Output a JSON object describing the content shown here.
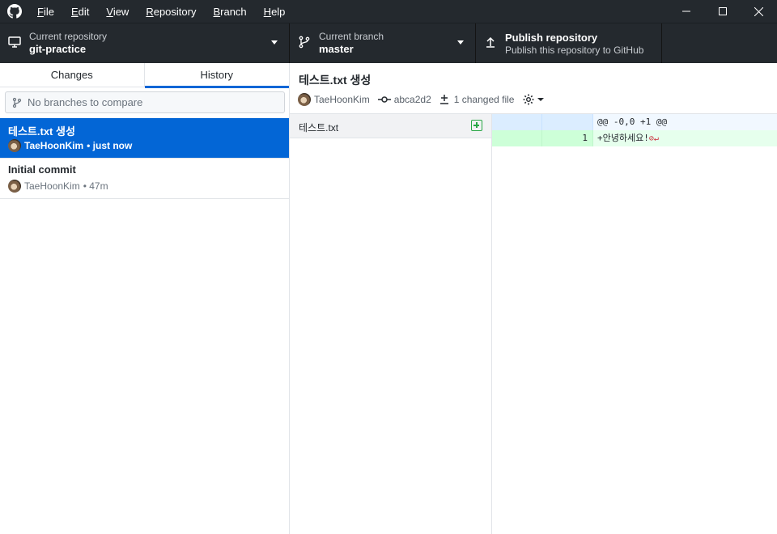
{
  "menu": {
    "items": [
      {
        "u": "F",
        "rest": "ile"
      },
      {
        "u": "E",
        "rest": "dit"
      },
      {
        "u": "V",
        "rest": "iew"
      },
      {
        "u": "R",
        "rest": "epository"
      },
      {
        "u": "B",
        "rest": "ranch"
      },
      {
        "u": "H",
        "rest": "elp"
      }
    ]
  },
  "toolbar": {
    "repo": {
      "caption": "Current repository",
      "value": "git-practice"
    },
    "branch": {
      "caption": "Current branch",
      "value": "master"
    },
    "publish": {
      "title": "Publish repository",
      "subtitle": "Publish this repository to GitHub"
    }
  },
  "sidebar": {
    "tabs": [
      {
        "label": "Changes"
      },
      {
        "label": "History"
      }
    ],
    "compare_placeholder": "No branches to compare",
    "commits": [
      {
        "title": "테스트.txt 생성",
        "author": "TaeHoonKim",
        "time": "• just now"
      },
      {
        "title": "Initial commit",
        "author": "TaeHoonKim",
        "time": "• 47m"
      }
    ]
  },
  "detail": {
    "title": "테스트.txt 생성",
    "author": "TaeHoonKim",
    "sha": "abca2d2",
    "changed": "1 changed file"
  },
  "files": [
    {
      "name": "테스트.txt"
    }
  ],
  "diff": {
    "hunk": "@@ -0,0 +1 @@",
    "line_no": "1",
    "line": "+안녕하세요!",
    "no_newline": "⊘↵"
  }
}
